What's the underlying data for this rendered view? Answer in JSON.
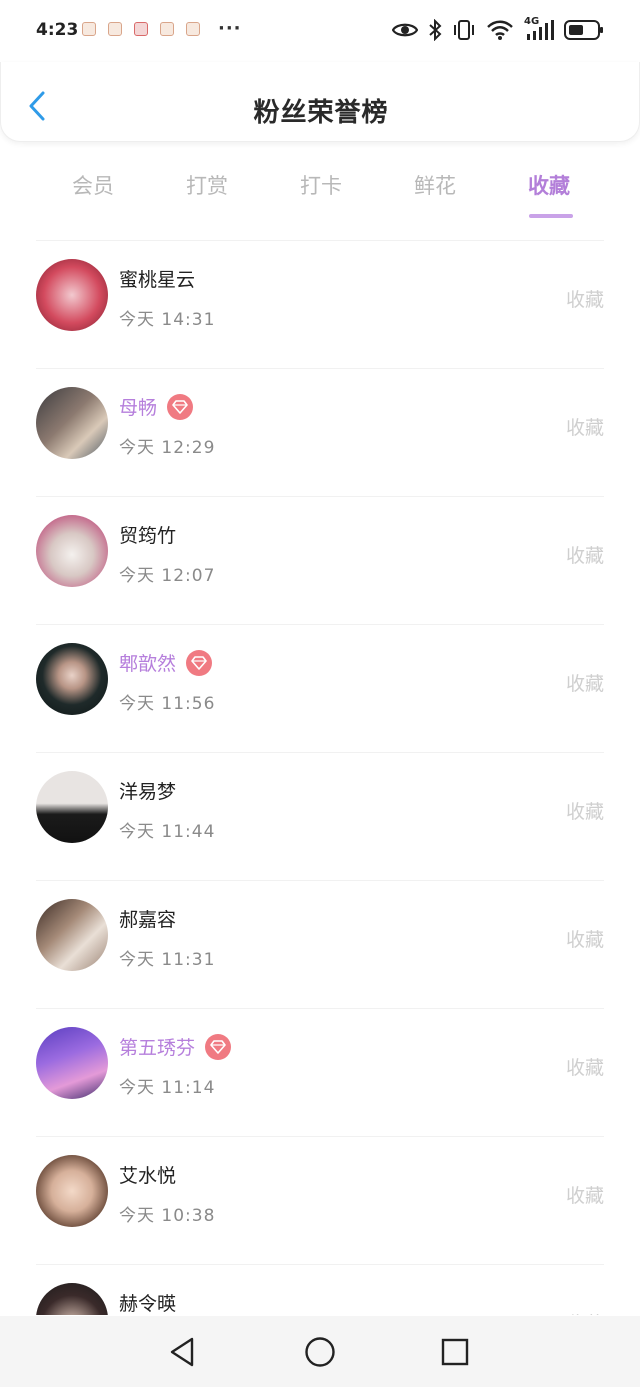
{
  "status_bar": {
    "time": "4:23",
    "more": "···",
    "network": "4G"
  },
  "header": {
    "title": "粉丝荣誉榜"
  },
  "tabs": [
    {
      "label": "会员",
      "active": false
    },
    {
      "label": "打赏",
      "active": false
    },
    {
      "label": "打卡",
      "active": false
    },
    {
      "label": "鲜花",
      "active": false
    },
    {
      "label": "收藏",
      "active": true
    }
  ],
  "fans": [
    {
      "name": "蜜桃星云",
      "time": "今天 14:31",
      "vip": false,
      "action": "收藏"
    },
    {
      "name": "母畅",
      "time": "今天 12:29",
      "vip": true,
      "action": "收藏"
    },
    {
      "name": "贸筠竹",
      "time": "今天 12:07",
      "vip": false,
      "action": "收藏"
    },
    {
      "name": "郫歆然",
      "time": "今天 11:56",
      "vip": true,
      "action": "收藏"
    },
    {
      "name": "洋易梦",
      "time": "今天 11:44",
      "vip": false,
      "action": "收藏"
    },
    {
      "name": "郝嘉容",
      "time": "今天 11:31",
      "vip": false,
      "action": "收藏"
    },
    {
      "name": "第五琇芬",
      "time": "今天 11:14",
      "vip": true,
      "action": "收藏"
    },
    {
      "name": "艾水悦",
      "time": "今天 10:38",
      "vip": false,
      "action": "收藏"
    },
    {
      "name": "赫令暎",
      "time": "",
      "vip": false,
      "action": "收藏"
    }
  ],
  "icons": {
    "back": "chevron-left-icon",
    "vip": "diamond-icon",
    "nav_back": "triangle-back-icon",
    "nav_home": "circle-home-icon",
    "nav_recents": "square-recents-icon"
  },
  "colors": {
    "accent": "#b37fd9",
    "vip_badge": "#f07a82",
    "back_arrow": "#2f9be8",
    "muted": "#cfcfcf"
  }
}
